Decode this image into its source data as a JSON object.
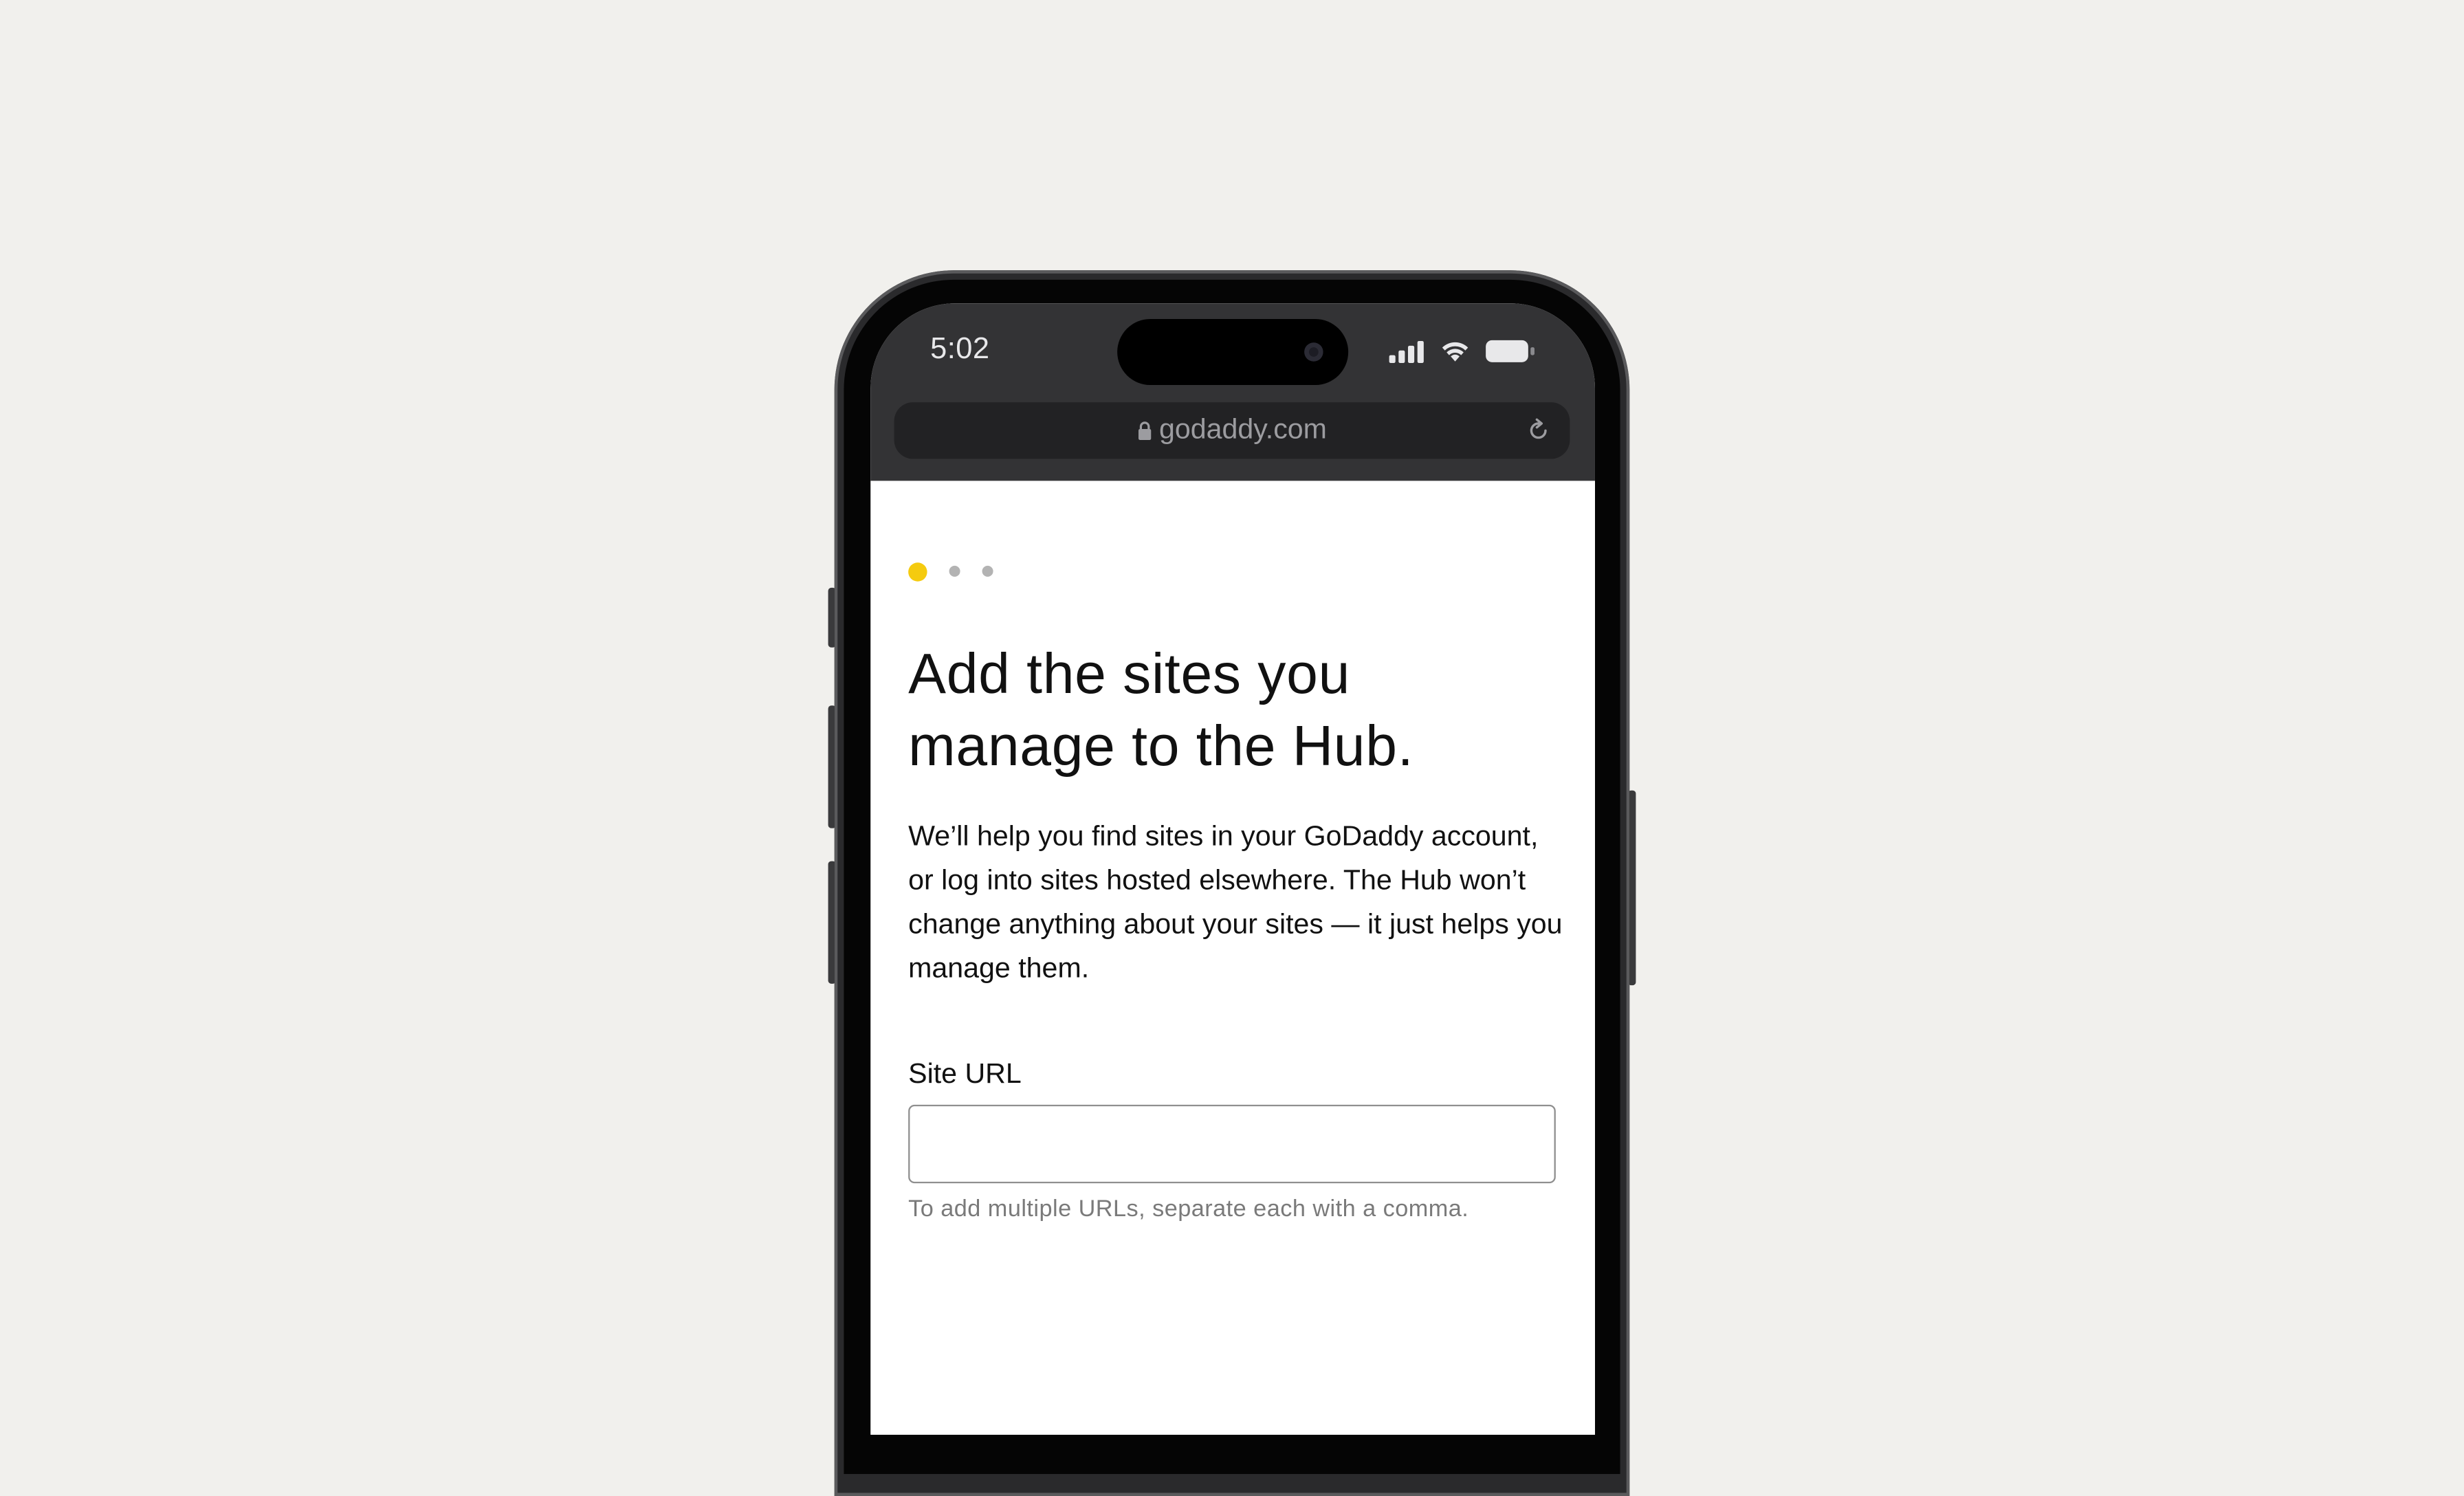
{
  "status_bar": {
    "time": "5:02",
    "icons": [
      "signal-icon",
      "wifi-icon",
      "battery-icon"
    ]
  },
  "browser": {
    "url": "godaddy.com",
    "icons": [
      "lock-icon",
      "reload-icon"
    ]
  },
  "stepper": {
    "total": 3,
    "active_index": 0,
    "active_color": "#f5cb0f",
    "inactive_color": "#b3b3b3"
  },
  "page": {
    "title": "Add the sites you manage to the Hub.",
    "description": "We’ll help you find sites in your GoDaddy account, or log into sites hosted elsewhere. The Hub won’t change anything about your sites — it just helps you manage them.",
    "site_url_field": {
      "label": "Site URL",
      "value": "",
      "placeholder": "",
      "helper": "To add multiple URLs, separate each with a comma."
    }
  },
  "colors": {
    "background": "#f1f0ed",
    "browser_chrome": "#333335",
    "accent": "#f5cb0f"
  }
}
